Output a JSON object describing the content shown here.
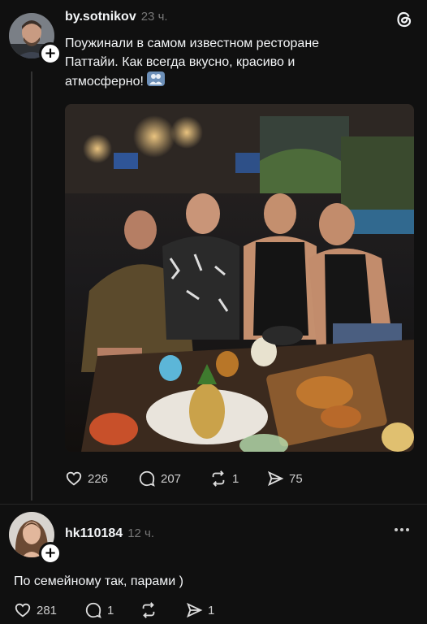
{
  "post": {
    "username": "by.sotnikov",
    "time": "23 ч.",
    "text_lines": [
      "Поужинали в самом известном ресторане",
      "Паттайи. Как всегда вкусно, красиво и",
      "атмосферно!"
    ],
    "likes": "226",
    "comments": "207",
    "reposts": "1",
    "shares": "75"
  },
  "reply": {
    "username": "hk110184",
    "time": "12 ч.",
    "text": "По семейному так, парами )",
    "likes": "281",
    "comments": "1",
    "shares": "1"
  },
  "icons": {
    "app_logo": "threads-logo-icon",
    "emoji": "couple-emoji-icon",
    "like": "heart-icon",
    "comment": "comment-bubble-icon",
    "repost": "repost-icon",
    "share": "send-icon",
    "more": "more-dots-icon"
  },
  "colors": {
    "background": "#101010",
    "text": "#f3f5f7",
    "muted": "#777777"
  }
}
